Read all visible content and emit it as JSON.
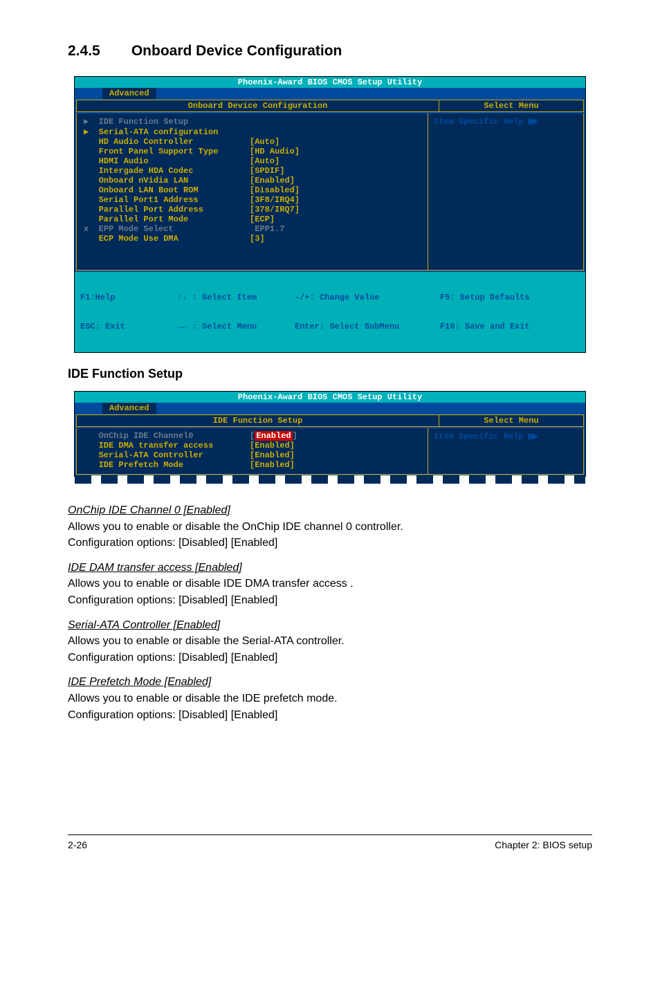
{
  "heading": {
    "number": "2.4.5",
    "title": "Onboard Device Configuration"
  },
  "bios1": {
    "ph_title": "Phoenix-Award BIOS CMOS Setup Utility",
    "tab": "Advanced",
    "panel_title": "Onboard Device Configuration",
    "select_menu": "Select Menu",
    "help_label": "Item Specific Help ",
    "rows": [
      {
        "marker": "▶",
        "label": "IDE Function Setup",
        "value": "",
        "grey": true
      },
      {
        "marker": "▶",
        "label": "Serial-ATA configuration",
        "value": ""
      },
      {
        "marker": " ",
        "label": "HD Audio Controller",
        "value": "[Auto]"
      },
      {
        "marker": " ",
        "label": "Front Panel Support Type",
        "value": "[HD Audio]"
      },
      {
        "marker": " ",
        "label": "HDMI Audio",
        "value": "[Auto]"
      },
      {
        "marker": " ",
        "label": "Intergade HDA Codec",
        "value": "[SPDIF]"
      },
      {
        "marker": " ",
        "label": "Onboard nVidia LAN",
        "value": "[Enabled]"
      },
      {
        "marker": " ",
        "label": "Onboard LAN Boot ROM",
        "value": "[Disabled]"
      },
      {
        "marker": " ",
        "label": "Serial Port1 Address",
        "value": "[3F8/IRQ4]"
      },
      {
        "marker": " ",
        "label": "Parallel Port Address",
        "value": "[378/IRQ7]"
      },
      {
        "marker": " ",
        "label": "Parallel Port Mode",
        "value": "[ECP]"
      },
      {
        "marker": "x",
        "label": "EPP Mode Select",
        "value": " EPP1.7",
        "grey": true
      },
      {
        "marker": " ",
        "label": "ECP Mode Use DMA",
        "value": "[3]"
      }
    ],
    "footer": {
      "c1a": "F1:Help",
      "c1b": "ESC: Exit",
      "c2a": "↑↓ : Select Item",
      "c2b": "→← : Select Menu",
      "c3a": "-/+: Change Value",
      "c3b": "Enter: Select SubMenu",
      "c4a": "F5: Setup Defaults",
      "c4b": "F10: Save and Exit"
    }
  },
  "sub_heading": "IDE Function Setup",
  "bios2": {
    "ph_title": "Phoenix-Award BIOS CMOS Setup Utility",
    "tab": "Advanced",
    "panel_title": "IDE Function Setup",
    "select_menu": "Select Menu",
    "help_label": "Item Specific Help ",
    "rows": [
      {
        "label": "OnChip IDE Channel0",
        "value_pre": "[",
        "value_hl": "Enabled",
        "value_post": "]",
        "grey": true
      },
      {
        "label": "IDE DMA transfer access",
        "value": "[Enabled]"
      },
      {
        "label": "Serial-ATA Controller",
        "value": "[Enabled]"
      },
      {
        "label": "IDE Prefetch Mode",
        "value": "[Enabled]"
      }
    ]
  },
  "descriptions": [
    {
      "title": "OnChip IDE Channel 0 [Enabled]",
      "line1": "Allows you to enable or disable the OnChip IDE channel 0 controller.",
      "line2": "Configuration options: [Disabled] [Enabled]"
    },
    {
      "title": "IDE DAM transfer access [Enabled]",
      "line1": "Allows you to enable or disable IDE DMA transfer access .",
      "line2": "Configuration options: [Disabled] [Enabled]"
    },
    {
      "title": "Serial-ATA Controller [Enabled]",
      "line1": "Allows you to enable or disable the Serial-ATA controller.",
      "line2": "Configuration options: [Disabled] [Enabled]"
    },
    {
      "title": "IDE Prefetch Mode [Enabled]",
      "line1": "Allows you to enable or disable the IDE prefetch mode.",
      "line2": "Configuration options: [Disabled] [Enabled]"
    }
  ],
  "page_footer": {
    "left": "2-26",
    "right": "Chapter 2: BIOS setup"
  }
}
